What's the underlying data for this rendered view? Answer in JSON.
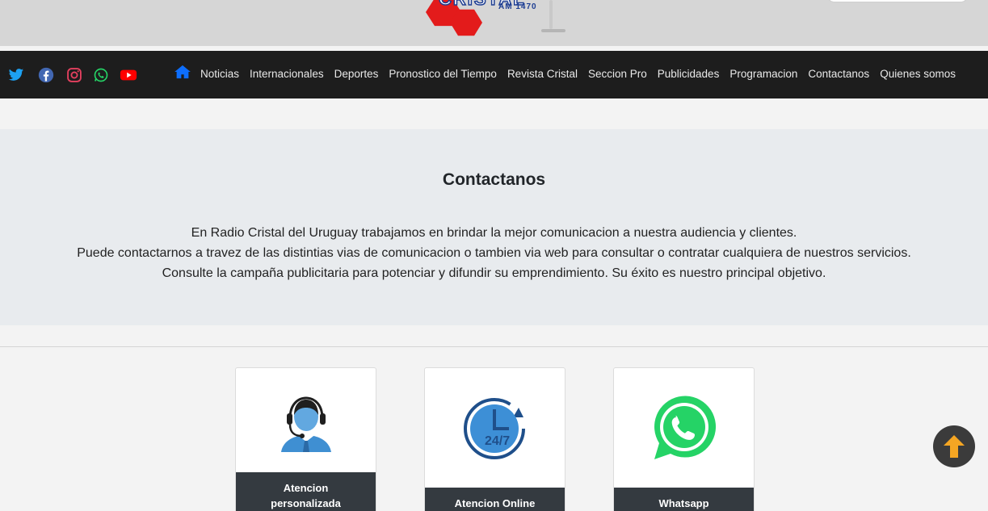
{
  "header": {
    "logo_text": "CRISTAL",
    "logo_sub": "AM 1470"
  },
  "social": [
    {
      "name": "twitter-icon",
      "color": "#1da1f2"
    },
    {
      "name": "facebook-icon",
      "color": "#4267b2"
    },
    {
      "name": "instagram-icon",
      "color": "#e4405f"
    },
    {
      "name": "whatsapp-icon",
      "color": "#25d366"
    },
    {
      "name": "youtube-icon",
      "color": "#ff0000"
    }
  ],
  "nav": {
    "home_icon": "home-icon",
    "items": [
      {
        "label": "Noticias"
      },
      {
        "label": "Internacionales"
      },
      {
        "label": "Deportes"
      },
      {
        "label": "Pronostico del Tiempo"
      },
      {
        "label": "Revista Cristal"
      },
      {
        "label": "Seccion Pro"
      },
      {
        "label": "Publicidades"
      },
      {
        "label": "Programacion"
      },
      {
        "label": "Contactanos"
      },
      {
        "label": "Quienes somos"
      }
    ]
  },
  "hero": {
    "title": "Contactanos",
    "lines": [
      "En Radio Cristal del Uruguay trabajamos en brindar la mejor comunicacion a nuestra audiencia y clientes.",
      "Puede contactarnos a travez de las distintias vias de comunicacion o tambien via web para consultar o contratar cualquiera de nuestros servicios.",
      "Consulte la campaña publicitaria para potenciar y difundir su emprendimiento. Su éxito es nuestro principal objetivo."
    ]
  },
  "cards": [
    {
      "label_line1": "Atencion",
      "label_line2": "personalizada",
      "icon": "customer-support-icon"
    },
    {
      "label": "Atencion Online",
      "icon": "clock-24-7-icon"
    },
    {
      "label": "Whatsapp",
      "icon": "whatsapp-icon"
    }
  ],
  "colors": {
    "navbar_bg": "#1d1d1d",
    "hero_bg": "#e8ebee",
    "card_label_bg": "#343a40",
    "accent_blue": "#0d6efd",
    "scroll_arrow": "#f5a623"
  }
}
